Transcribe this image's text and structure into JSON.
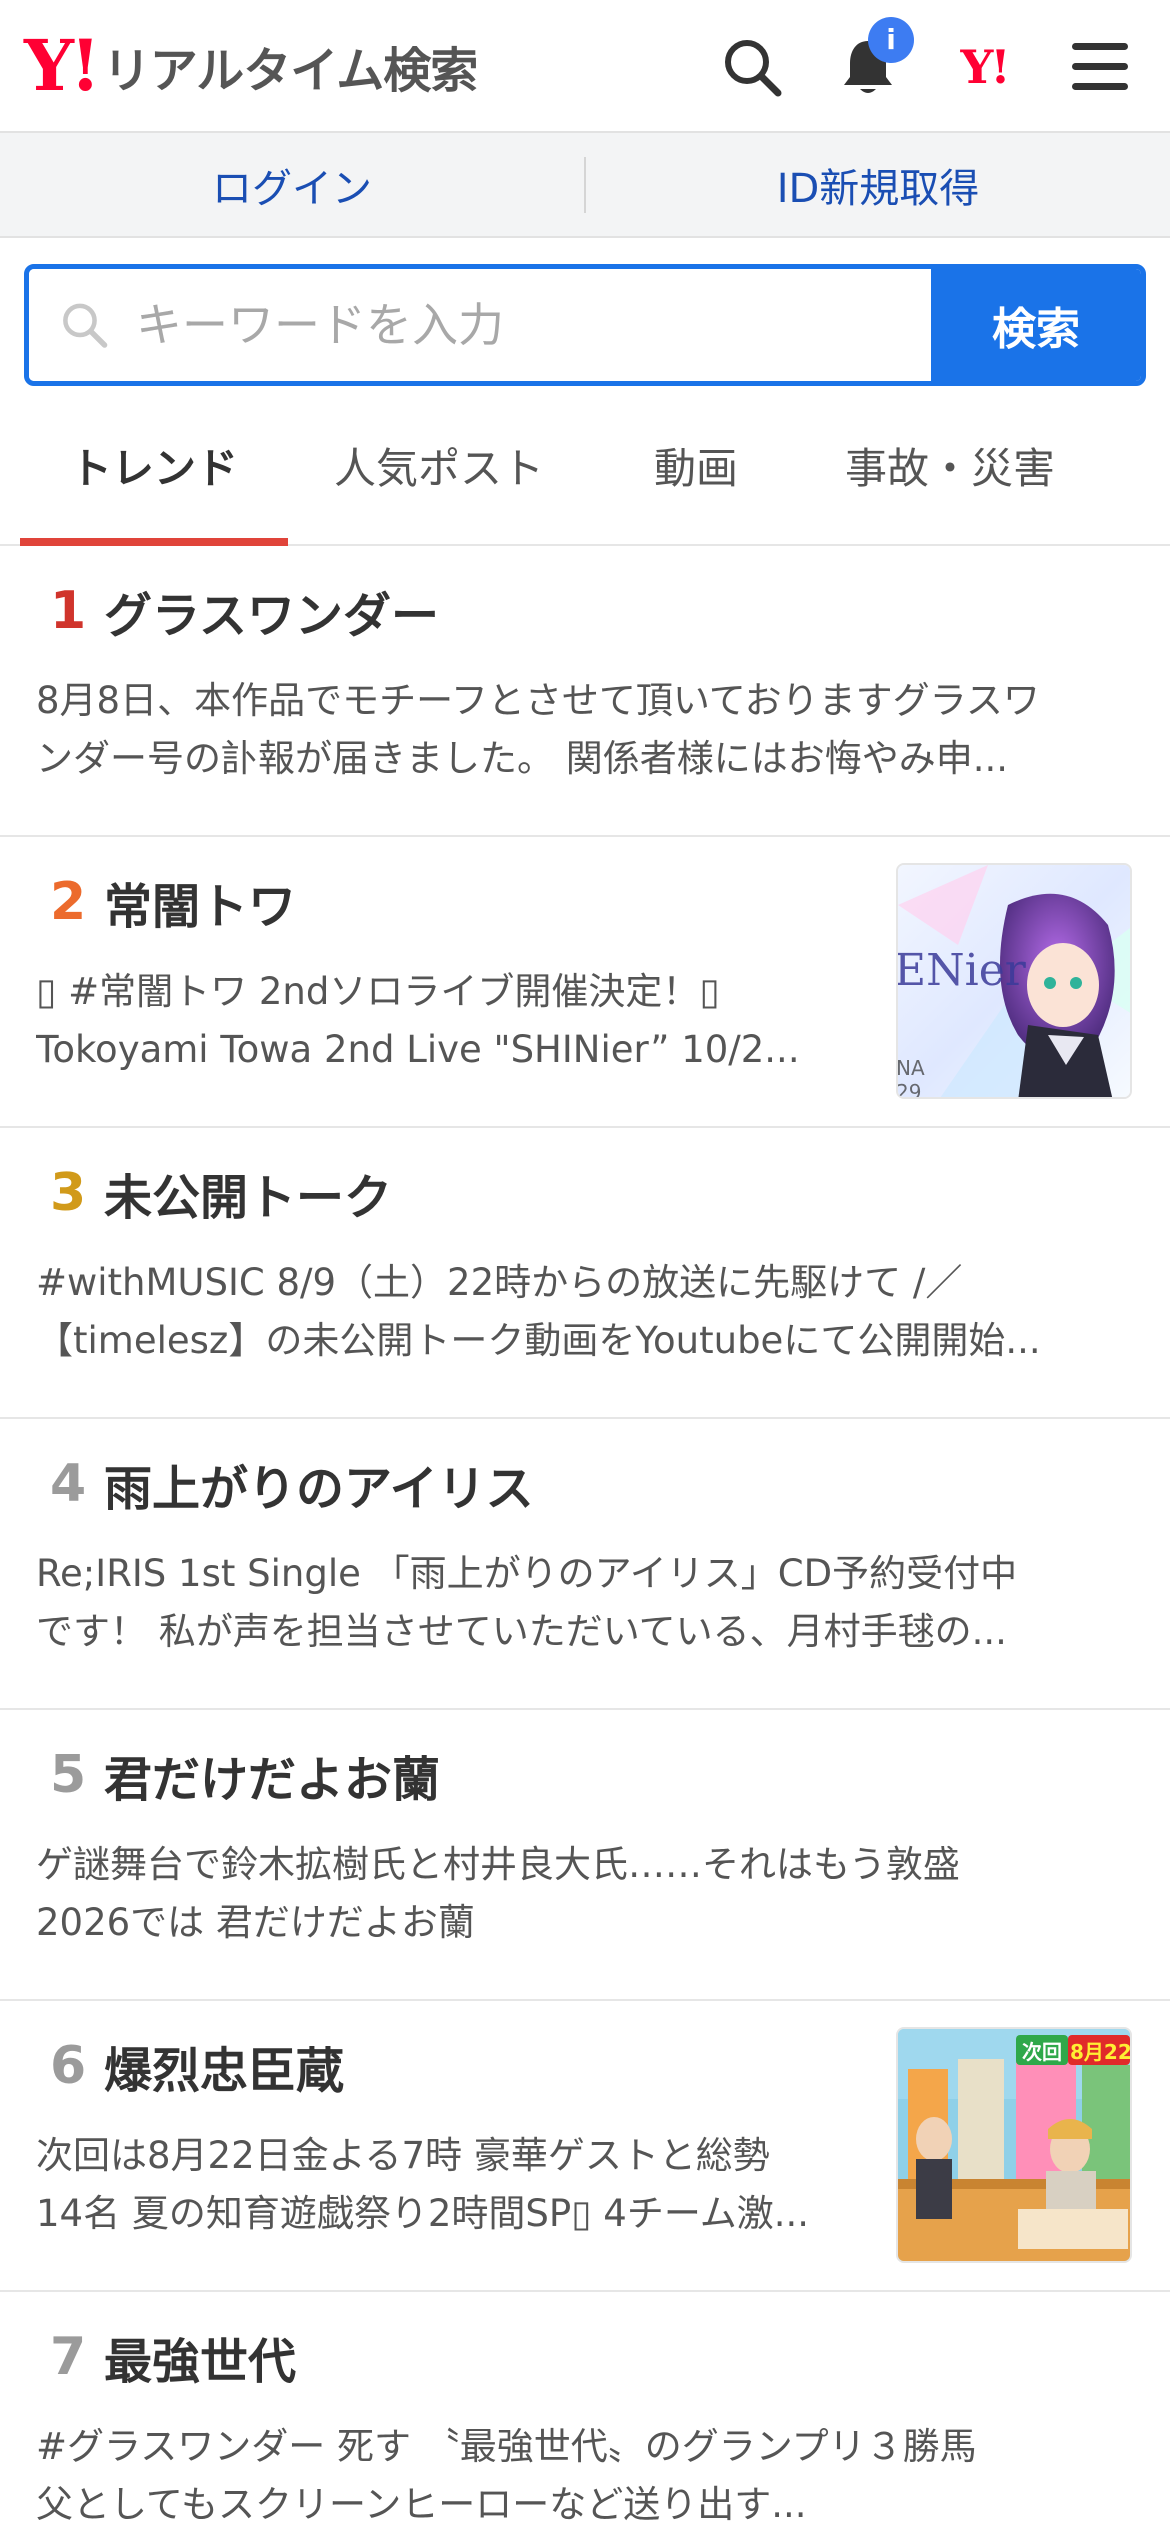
{
  "header": {
    "logo_mark": "Y!",
    "logo_text": "リアルタイム検索",
    "notification_badge": "i",
    "yahoo_mark": "Y!",
    "icons": [
      "search-icon",
      "bell-icon",
      "yahoo-logo-icon",
      "menu-icon"
    ]
  },
  "auth": {
    "login": "ログイン",
    "register": "ID新規取得"
  },
  "search": {
    "placeholder": "キーワードを入力",
    "button": "検索"
  },
  "tabs": [
    {
      "label": "トレンド",
      "active": true
    },
    {
      "label": "人気ポスト",
      "active": false
    },
    {
      "label": "動画",
      "active": false
    },
    {
      "label": "事故・災害",
      "active": false
    }
  ],
  "trends": [
    {
      "rank": "1",
      "title": "グラスワンダー",
      "line1": "8月8日、本作品でモチーフとさせて頂いておりますグラスワ",
      "line2": "ンダー号の訃報が届きました。 関係者様にはお悔やみ申...",
      "thumb": null
    },
    {
      "rank": "2",
      "title": "常闇トワ",
      "line1": "▯ #常闇トワ 2ndソロライブ開催決定！▯",
      "line2": "Tokoyami Towa 2nd Live \"SHINier” 10/2...",
      "thumb": "anime-artwork"
    },
    {
      "rank": "3",
      "title": "未公開トーク",
      "line1": "#withMUSIC 8/9（土）22時からの放送に先駆けて /／",
      "line2": "【timelesz】の未公開トーク動画をYoutubeにて公開開始...",
      "thumb": null
    },
    {
      "rank": "4",
      "title": "雨上がりのアイリス",
      "line1": "Re;IRIS 1st Single 「雨上がりのアイリス」CD予約受付中",
      "line2": "です！ 私が声を担当させていただいている、月村手毬の...",
      "thumb": null
    },
    {
      "rank": "5",
      "title": "君だけだよお蘭",
      "line1": "ゲ謎舞台で鈴木拡樹氏と村井良大氏……それはもう敦盛",
      "line2": "2026では 君だけだよお蘭",
      "thumb": null
    },
    {
      "rank": "6",
      "title": "爆烈忠臣蔵",
      "line1": "次回は8月22日金よる7時 豪華ゲストと総勢",
      "line2": "14名 夏の知育遊戯祭り2時間SP▯ 4チーム激...",
      "thumb": "tv-show",
      "thumb_caption_1": "次回",
      "thumb_caption_2": "8月22日"
    },
    {
      "rank": "7",
      "title": "最強世代",
      "line1": "#グラスワンダー 死す 〝最強世代〟のグランプリ３勝馬",
      "line2": "父としてもスクリーンヒーローなど送り出す...",
      "thumb": null
    }
  ],
  "colors": {
    "brand_red": "#ff0033",
    "accent_blue": "#1a73e8",
    "link_blue": "#1a4eb3",
    "tab_underline": "#e0443a"
  }
}
